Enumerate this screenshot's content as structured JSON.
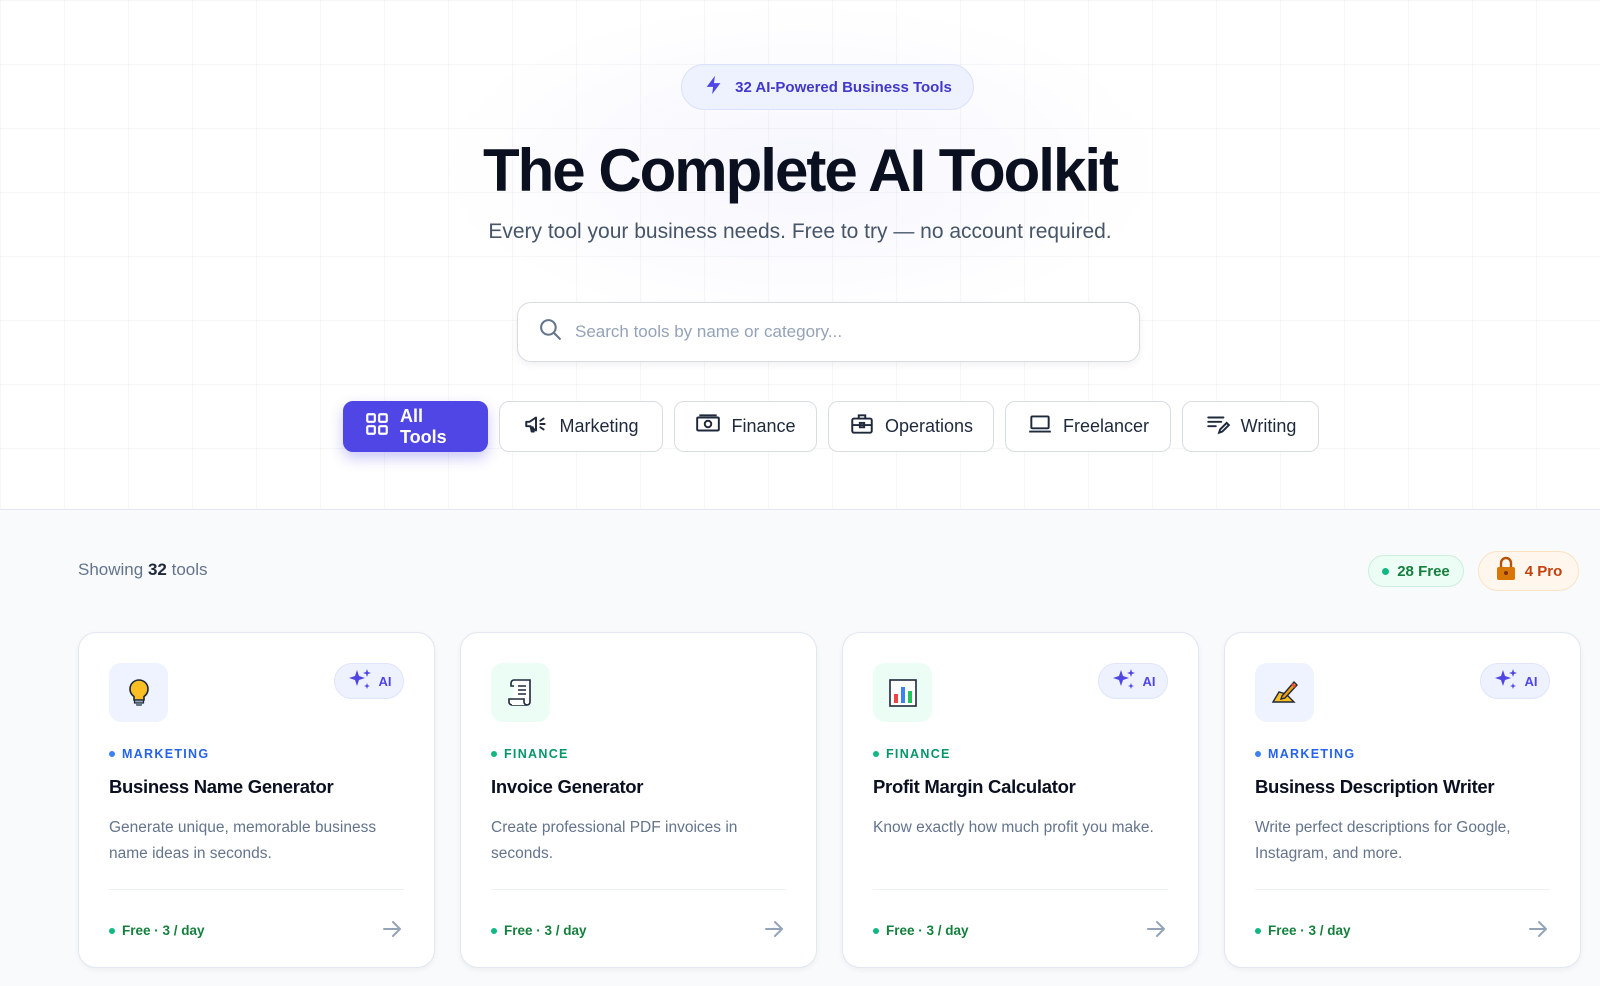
{
  "hero": {
    "pill_label": "32 AI-Powered Business Tools",
    "title": "The Complete AI Toolkit",
    "subtitle": "Every tool your business needs. Free to try — no account required.",
    "search_placeholder": "Search tools by name or category..."
  },
  "tabs": [
    {
      "label": "All Tools",
      "icon": "grid-icon",
      "active": true
    },
    {
      "label": "Marketing",
      "icon": "megaphone-icon",
      "active": false
    },
    {
      "label": "Finance",
      "icon": "banknote-icon",
      "active": false
    },
    {
      "label": "Operations",
      "icon": "briefcase-icon",
      "active": false
    },
    {
      "label": "Freelancer",
      "icon": "laptop-icon",
      "active": false
    },
    {
      "label": "Writing",
      "icon": "text-edit-icon",
      "active": false
    }
  ],
  "summary": {
    "showing_prefix": "Showing",
    "count": "32",
    "showing_suffix": "tools",
    "free_badge": "28 Free",
    "pro_badge": "4 Pro"
  },
  "cards": [
    {
      "icon": "lightbulb-icon",
      "ai_label": "AI",
      "category": "MARKETING",
      "category_color": "#3b82f6",
      "title": "Business Name Generator",
      "description": "Generate unique, memorable business name ideas in seconds.",
      "footer": "Free · 3 / day"
    },
    {
      "icon": "scroll-icon",
      "ai_label": "",
      "category": "FINANCE",
      "category_color": "#10b981",
      "title": "Invoice Generator",
      "description": "Create professional PDF invoices in seconds.",
      "footer": "Free · 3 / day"
    },
    {
      "icon": "bar-chart-icon",
      "ai_label": "AI",
      "category": "FINANCE",
      "category_color": "#10b981",
      "title": "Profit Margin Calculator",
      "description": "Know exactly how much profit you make.",
      "footer": "Free · 3 / day"
    },
    {
      "icon": "writing-hand-icon",
      "ai_label": "AI",
      "category": "MARKETING",
      "category_color": "#3b82f6",
      "title": "Business Description Writer",
      "description": "Write perfect descriptions for Google, Instagram, and more.",
      "footer": "Free · 3 / day"
    }
  ],
  "colors": {
    "accent": "#4f46e5",
    "free_green": "#15803d",
    "pro_orange": "#c2410c"
  }
}
